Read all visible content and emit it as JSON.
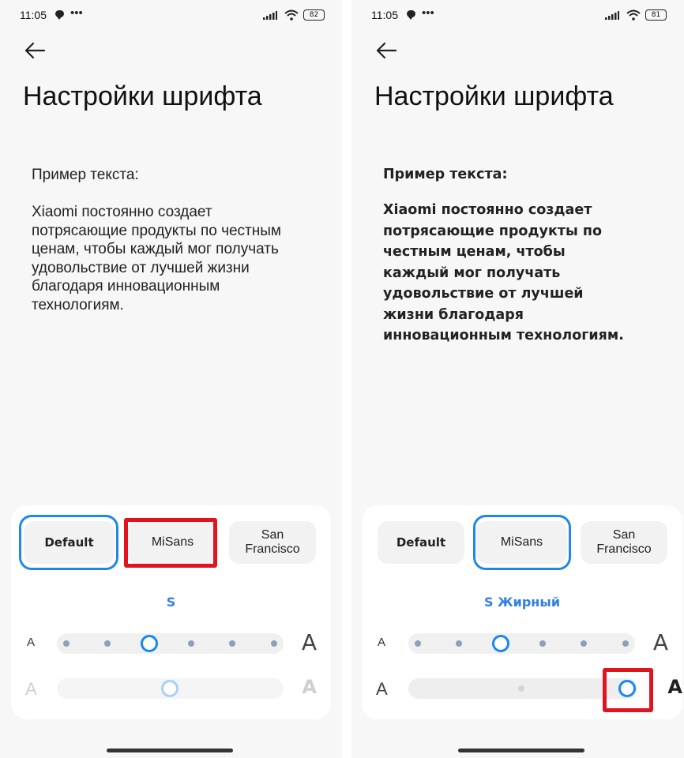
{
  "screens": [
    {
      "status": {
        "time": "11:05",
        "battery": "82"
      },
      "title": "Настройки шрифта",
      "preview": {
        "label": "Пример текста:",
        "text": "Xiaomi постоянно создает потрясающие продукты по честным ценам, чтобы каждый мог получать удовольствие от лучшей жизни благодаря инновационным технологиям."
      },
      "fonts": [
        "Default",
        "MiSans",
        "San Francisco"
      ],
      "selected_font": "Default",
      "highlighted_font": "MiSans",
      "size_label": "S",
      "size_slider": {
        "letter_small": "A",
        "letter_large": "A",
        "steps": 6,
        "selected_step": 3
      },
      "weight_slider": {
        "letter_small": "A",
        "letter_large": "A",
        "value": 0.5,
        "enabled": false
      }
    },
    {
      "status": {
        "time": "11:05",
        "battery": "81"
      },
      "title": "Настройки шрифта",
      "preview": {
        "label": "Пример текста:",
        "text": "Xiaomi постоянно создает потрясающие продукты по честным ценам, чтобы каждый мог получать удовольствие от лучшей жизни благодаря инновационным технологиям."
      },
      "fonts": [
        "Default",
        "MiSans",
        "San Francisco"
      ],
      "selected_font": "MiSans",
      "highlighted_font": "",
      "size_label": "S Жирный",
      "size_slider": {
        "letter_small": "A",
        "letter_large": "A",
        "steps": 6,
        "selected_step": 3
      },
      "weight_slider": {
        "letter_small": "A",
        "letter_large": "A",
        "value": 1.0,
        "enabled": true,
        "highlighted": true
      }
    }
  ],
  "accent_color": "#1e88e5",
  "highlight_color": "#e0141e",
  "label_color": "#2f7fe5"
}
